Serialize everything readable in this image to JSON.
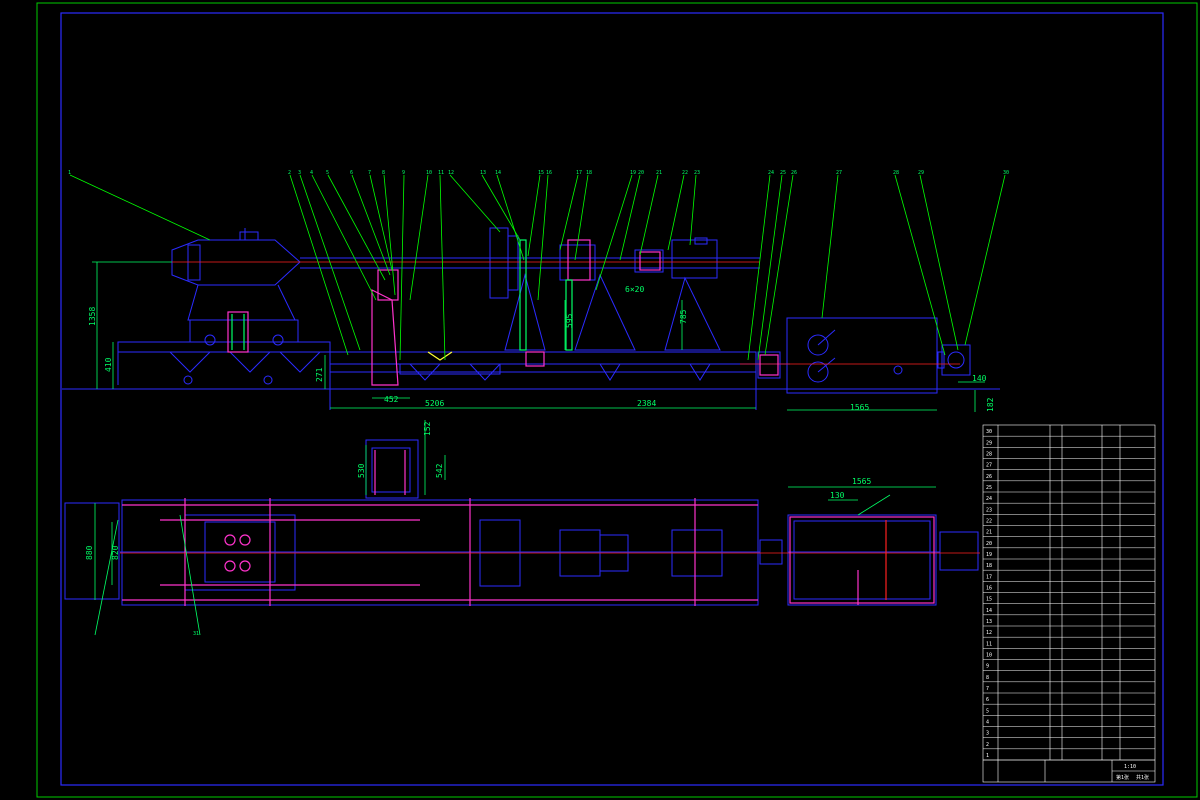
{
  "drawing": {
    "title_block": {
      "scale": "1:10",
      "sheet": "第1张",
      "total": "共1张"
    },
    "dimensions": {
      "d1358": "1358",
      "d410": "410",
      "d271": "271",
      "d452": "452",
      "d5206": "5206",
      "d2384": "2384",
      "d1565a": "1565",
      "d140": "140",
      "d182": "182",
      "d880": "880",
      "d820": "820",
      "d530": "530",
      "d542": "542",
      "d152": "152",
      "d1565b": "1565",
      "d130": "130",
      "d595": "595",
      "d785": "785",
      "d6x20": "6×20"
    },
    "balloons": [
      "1",
      "2",
      "3",
      "4",
      "5",
      "6",
      "7",
      "8",
      "9",
      "10",
      "11",
      "12",
      "13",
      "14",
      "15",
      "16",
      "17",
      "18",
      "19",
      "20",
      "21",
      "22",
      "23",
      "24",
      "25",
      "26",
      "27",
      "28",
      "29",
      "30",
      "31"
    ],
    "bom_rows": [
      "30",
      "29",
      "28",
      "27",
      "26",
      "25",
      "24",
      "23",
      "22",
      "21",
      "20",
      "19",
      "18",
      "17",
      "16",
      "15",
      "14",
      "13",
      "12",
      "11",
      "10",
      "9",
      "8",
      "7",
      "6",
      "5",
      "4",
      "3",
      "2",
      "1"
    ],
    "colors": {
      "frame": "#00cc00",
      "machine": "#2b2bff",
      "centerline": "#ff2020",
      "dimension": "#00ff66",
      "leader": "#00ff00",
      "magenta": "#ff33cc",
      "yellow": "#ffff33",
      "text": "#ffffff"
    }
  }
}
